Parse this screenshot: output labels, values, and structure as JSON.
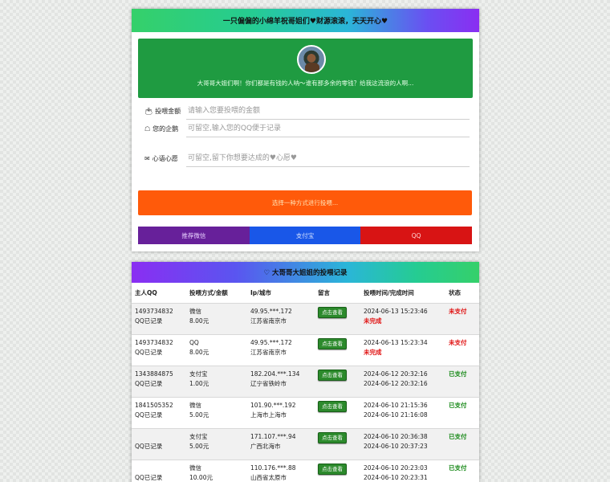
{
  "header": {
    "title": "一只偏偏的小绵羊祝哥姐们♥财源滚滚，天天开心♥"
  },
  "hero": {
    "message": "大哥哥大姐们啊！你们都是有钱的人呐～谁有那多余的零钱？给我这流浪的人啊..."
  },
  "form": {
    "amount": {
      "label": "投喂金额",
      "icon": "wallet-icon",
      "placeholder": "请输入您要投喂的金额"
    },
    "qq": {
      "label": "您的企鹅",
      "icon": "penguin-icon",
      "placeholder": "可留空,输入您的QQ便于记录"
    },
    "wish": {
      "label": "心语心愿",
      "icon": "envelope-icon",
      "placeholder": "可留空,留下你想要达成的♥心愿♥"
    }
  },
  "select_prompt": "选择一种方式进行投喂...",
  "pay": {
    "wechat": "推荐微信",
    "alipay": "支付宝",
    "qq": "QQ"
  },
  "records": {
    "title": "♡ 大哥哥大姐姐的投喂记录",
    "headers": [
      "主人QQ",
      "投喂方式/金额",
      "Ip/城市",
      "留言",
      "投喂时间/完成时间",
      "状态"
    ],
    "see_label": "点击查看",
    "rows": [
      {
        "qq": "1493734832",
        "qq_note": "QQ已记录",
        "method": "微信",
        "amount": "8.00元",
        "ip": "49.95.***.172",
        "city": "江苏省南京市",
        "time": "2024-06-13 15:23:46",
        "done": "未完成",
        "status": "未支付"
      },
      {
        "qq": "1493734832",
        "qq_note": "QQ已记录",
        "method": "QQ",
        "amount": "8.00元",
        "ip": "49.95.***.172",
        "city": "江苏省南京市",
        "time": "2024-06-13 15:23:34",
        "done": "未完成",
        "status": "未支付"
      },
      {
        "qq": "1343884875",
        "qq_note": "QQ已记录",
        "method": "支付宝",
        "amount": "1.00元",
        "ip": "182.204.***.134",
        "city": "辽宁省铁岭市",
        "time": "2024-06-12 20:32:16",
        "done": "2024-06-12 20:32:16",
        "status": "已支付"
      },
      {
        "qq": "1841505352",
        "qq_note": "QQ已记录",
        "method": "微信",
        "amount": "5.00元",
        "ip": "101.90.***.192",
        "city": "上海市上海市",
        "time": "2024-06-10 21:15:36",
        "done": "2024-06-10 21:16:08",
        "status": "已支付"
      },
      {
        "qq": "",
        "qq_note": "QQ已记录",
        "method": "支付宝",
        "amount": "5.00元",
        "ip": "171.107.***.94",
        "city": "广西北海市",
        "time": "2024-06-10 20:36:38",
        "done": "2024-06-10 20:37:23",
        "status": "已支付"
      },
      {
        "qq": "",
        "qq_note": "QQ已记录",
        "method": "微信",
        "amount": "10.00元",
        "ip": "110.176.***.88",
        "city": "山西省太原市",
        "time": "2024-06-10 20:23:03",
        "done": "2024-06-10 20:23:31",
        "status": "已支付"
      }
    ]
  }
}
